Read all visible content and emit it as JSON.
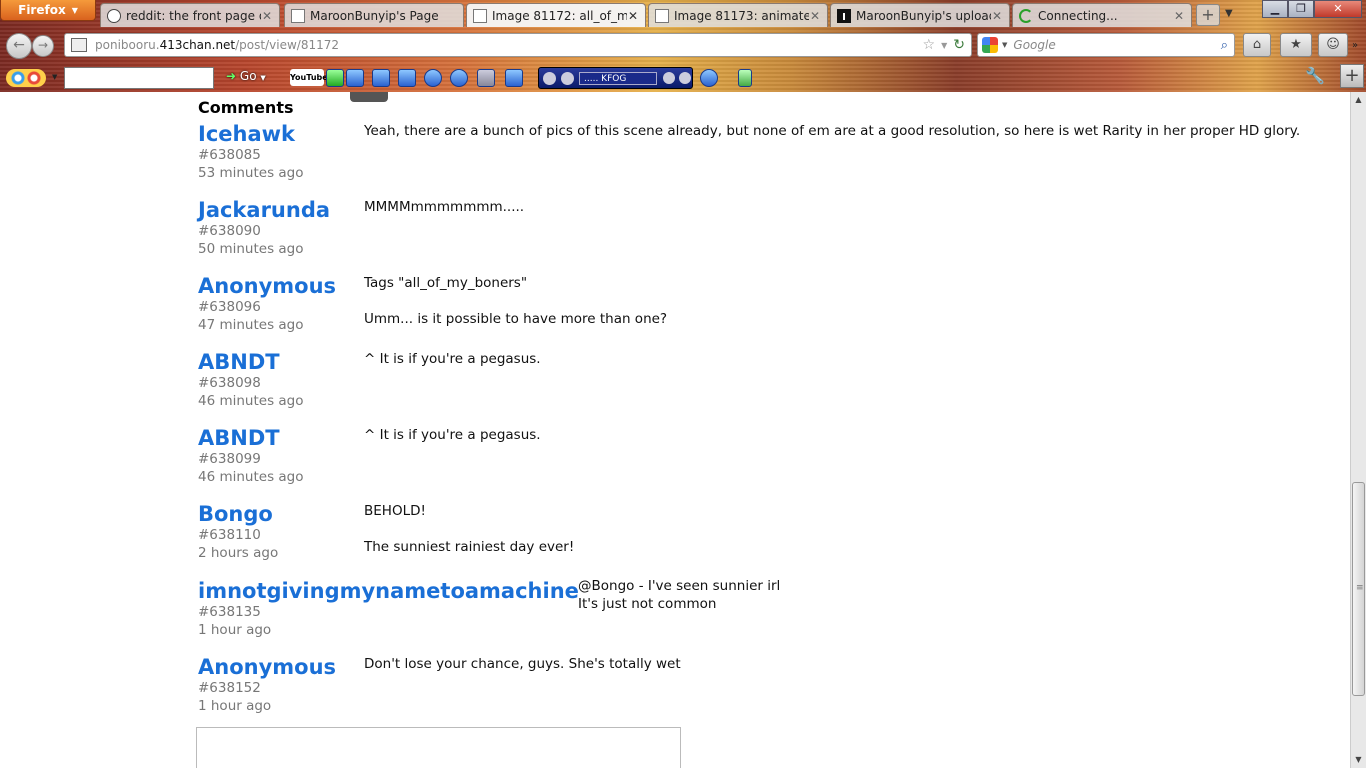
{
  "browser": {
    "menu_button": "Firefox",
    "tabs": [
      {
        "title": "reddit: the front page of ..."
      },
      {
        "title": "MaroonBunyip's Page"
      },
      {
        "title": "Image 81172: all_of_my_..."
      },
      {
        "title": "Image 81173: animated ..."
      },
      {
        "title": "MaroonBunyip's upload..."
      },
      {
        "title": "Connecting..."
      }
    ],
    "url_prefix": "ponibooru.",
    "url_domain": "413chan.net",
    "url_path": "/post/view/81172",
    "search_placeholder": "Google",
    "toolbar": {
      "go_label": "Go",
      "youtube_label": "YouTube",
      "radio_station": "..... KFOG"
    }
  },
  "page": {
    "comments_heading": "Comments",
    "comments": [
      {
        "user": "Icehawk",
        "id": "#638085",
        "time": "53 minutes ago",
        "body": "Yeah, there are a bunch of pics of this scene already, but none of em are at a good resolution, so here is wet Rarity in her proper HD glory."
      },
      {
        "user": "Jackarunda",
        "id": "#638090",
        "time": "50 minutes ago",
        "body": "MMMMmmmmmmm....."
      },
      {
        "user": "Anonymous",
        "id": "#638096",
        "time": "47 minutes ago",
        "body": "Tags \"all_of_my_boners\"\n\nUmm... is it possible to have more than one?"
      },
      {
        "user": "ABNDT",
        "id": "#638098",
        "time": "46 minutes ago",
        "body": "^ It is if you're a pegasus."
      },
      {
        "user": "ABNDT",
        "id": "#638099",
        "time": "46 minutes ago",
        "body": "^ It is if you're a pegasus."
      },
      {
        "user": "Bongo",
        "id": "#638110",
        "time": "2 hours ago",
        "body": "BEHOLD!\n\nThe sunniest rainiest day ever!"
      },
      {
        "user": "imnotgivingmynametoamachine",
        "id": "#638135",
        "time": "1 hour ago",
        "body": "@Bongo - I've seen sunnier irl\nIt's just not common"
      },
      {
        "user": "Anonymous",
        "id": "#638152",
        "time": "1 hour ago",
        "body": "Don't lose your chance, guys. She's totally wet"
      }
    ]
  },
  "colors": {
    "username": "#1a6fd6",
    "meta": "#777777"
  }
}
